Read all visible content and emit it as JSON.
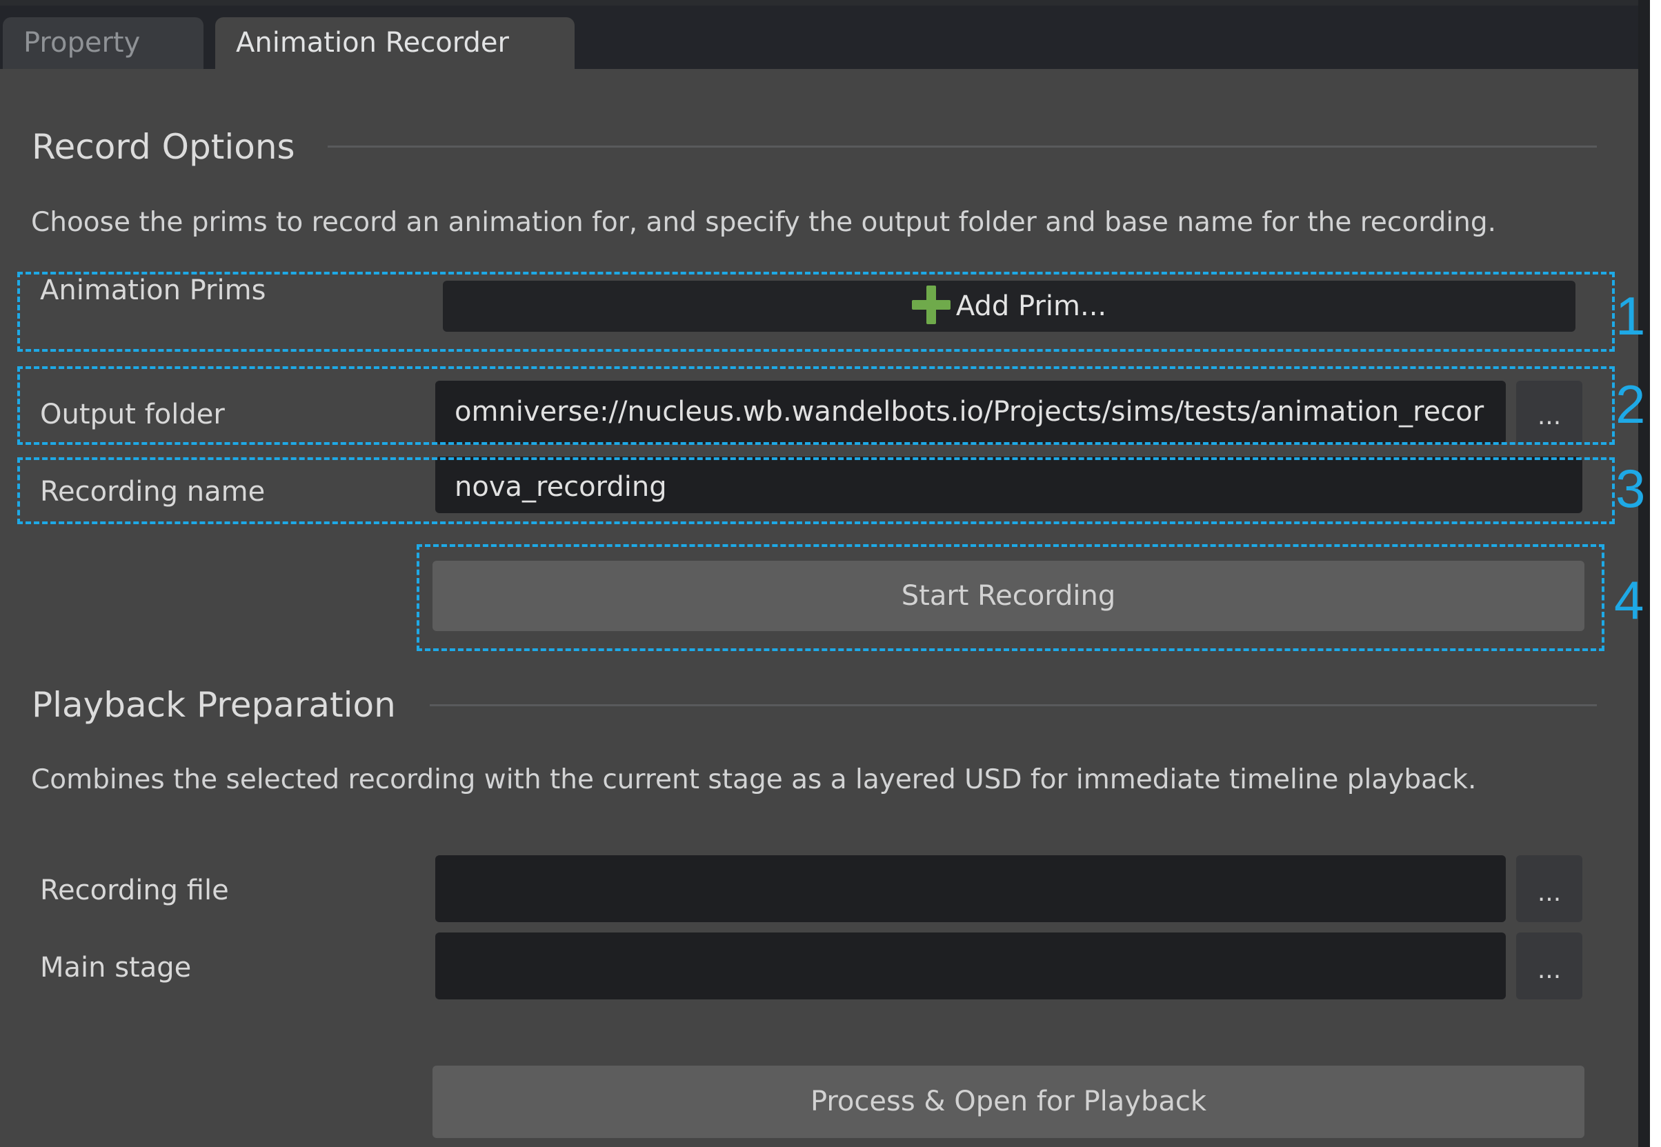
{
  "tabs": [
    {
      "label": "Property",
      "active": false
    },
    {
      "label": "Animation Recorder",
      "active": true
    }
  ],
  "record_options": {
    "title": "Record Options",
    "description": "Choose the prims to record an animation for, and specify the output folder and base name for the recording.",
    "animation_prims_label": "Animation Prims",
    "add_prim_label": "Add Prim...",
    "output_folder_label": "Output folder",
    "output_folder_value": "omniverse://nucleus.wb.wandelbots.io/Projects/sims/tests/animation_recor",
    "browse_label": "...",
    "recording_name_label": "Recording name",
    "recording_name_value": "nova_recording",
    "start_recording_label": "Start Recording"
  },
  "playback": {
    "title": "Playback Preparation",
    "description": "Combines the selected recording with the current stage as a layered USD for immediate timeline playback.",
    "recording_file_label": "Recording file",
    "recording_file_value": "",
    "main_stage_label": "Main stage",
    "main_stage_value": "",
    "browse_label": "...",
    "process_label": "Process & Open for Playback"
  },
  "annotations": [
    "1",
    "2",
    "3",
    "4"
  ],
  "colors": {
    "annotation": "#1ea9e6",
    "panel_bg": "#454545",
    "field_bg": "#1e1f22",
    "add_icon": "#6faa4b"
  },
  "icons": {
    "add_prim": "plus-icon"
  }
}
